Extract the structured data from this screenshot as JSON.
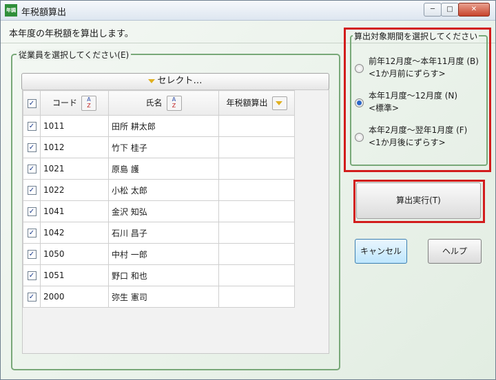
{
  "window": {
    "title": "年税額算出",
    "icon_text": "年調"
  },
  "description": "本年度の年税額を算出します。",
  "employee_group": {
    "legend": "従業員を選択してください(E)",
    "select_label": "セレクト…",
    "columns": {
      "code": "コード",
      "name": "氏名",
      "tax": "年税額算出"
    },
    "rows": [
      {
        "code": "1011",
        "name": "田所 耕太郎",
        "checked": true,
        "tax": ""
      },
      {
        "code": "1012",
        "name": "竹下 桂子",
        "checked": true,
        "tax": ""
      },
      {
        "code": "1021",
        "name": "原島 護",
        "checked": true,
        "tax": ""
      },
      {
        "code": "1022",
        "name": "小松 太郎",
        "checked": true,
        "tax": ""
      },
      {
        "code": "1041",
        "name": "金沢 知弘",
        "checked": true,
        "tax": ""
      },
      {
        "code": "1042",
        "name": "石川 昌子",
        "checked": true,
        "tax": ""
      },
      {
        "code": "1050",
        "name": "中村 一郎",
        "checked": true,
        "tax": ""
      },
      {
        "code": "1051",
        "name": "野口 和也",
        "checked": true,
        "tax": ""
      },
      {
        "code": "2000",
        "name": "弥生 憲司",
        "checked": true,
        "tax": ""
      }
    ]
  },
  "period_group": {
    "legend": "算出対象期間を選択してください",
    "options": [
      {
        "line1": "前年12月度～本年11月度 (B)",
        "line2": "<1か月前にずらす>",
        "selected": false
      },
      {
        "line1": "本年1月度～12月度 (N)",
        "line2": "<標準>",
        "selected": true
      },
      {
        "line1": "本年2月度～翌年1月度 (F)",
        "line2": "<1か月後にずらす>",
        "selected": false
      }
    ]
  },
  "buttons": {
    "calculate": "算出実行(T)",
    "cancel": "キャンセル",
    "help": "ヘルプ"
  },
  "colors": {
    "highlight": "#d21c1c",
    "group_border": "#78a878",
    "background": "#e8f0e8"
  }
}
